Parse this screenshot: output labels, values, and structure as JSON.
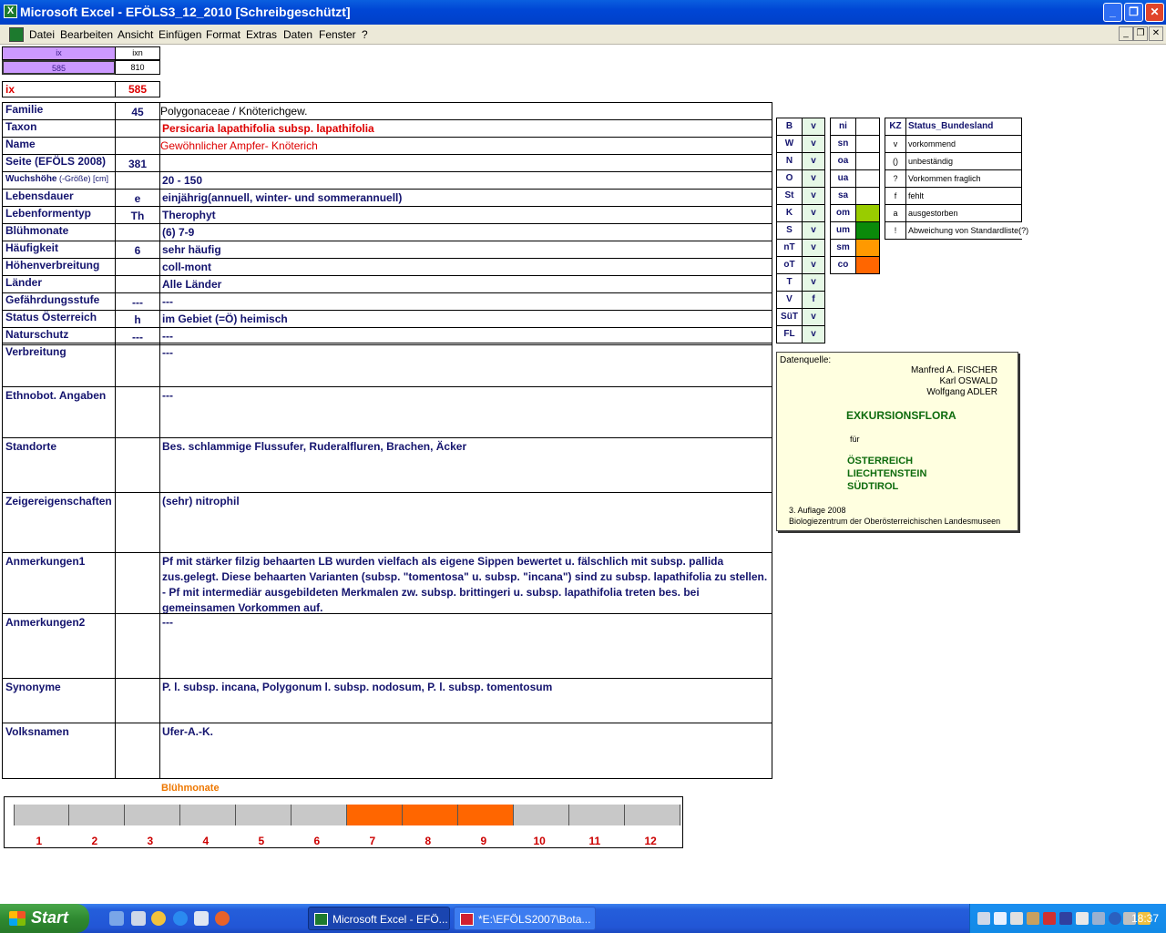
{
  "window": {
    "title": "Microsoft Excel - EFÖLS3_12_2010  [Schreibgeschützt]",
    "app_icon": "excel-icon"
  },
  "menu": [
    "Datei",
    "Bearbeiten",
    "Ansicht",
    "Einfügen",
    "Format",
    "Extras",
    "Daten",
    "Fenster",
    "?"
  ],
  "top_cells": {
    "ix_header": "ix",
    "ixn_header": "ixn",
    "ix_value": "585",
    "ixn_value": "810",
    "ix_label": "ix",
    "ix_big": "585"
  },
  "rows": [
    {
      "label": "Familie",
      "code": "45",
      "value": "Polygonaceae  /  Knöterichgew."
    },
    {
      "label": "Taxon",
      "code": "",
      "value": "Persicaria lapathifolia subsp. lapathifolia"
    },
    {
      "label": "Name",
      "code": "",
      "value": "Gewöhnlicher Ampfer- Knöterich"
    },
    {
      "label": "Seite (EFÖLS 2008)",
      "code": "381",
      "value": ""
    },
    {
      "label": "Wuchshöhe",
      "label_sub": "(-Größe) [cm]",
      "code": "",
      "value": " 20 - 150"
    },
    {
      "label": "Lebensdauer",
      "code": "e",
      "value": "einjährig(annuell, winter- und sommerannuell)"
    },
    {
      "label": "Lebenformentyp",
      "code": "Th",
      "value": "Therophyt"
    },
    {
      "label": "Blühmonate",
      "code": "",
      "value": "(6) 7-9"
    },
    {
      "label": "Häufigkeit",
      "code": "6",
      "value": "sehr häufig"
    },
    {
      "label": "Höhenverbreitung",
      "code": "",
      "value": "coll-mont"
    },
    {
      "label": "Länder",
      "code": "",
      "value": "Alle Länder"
    },
    {
      "label": "Gefährdungsstufe",
      "code": "---",
      "value": "  ---"
    },
    {
      "label": "Status Österreich",
      "code": "h",
      "value": "im Gebiet (=Ö) heimisch"
    },
    {
      "label": "Naturschutz",
      "code": "---",
      "value": " ---"
    }
  ],
  "tall_rows": [
    {
      "label": "Verbreitung",
      "value": " ---"
    },
    {
      "label": "Ethnobot. Angaben",
      "value": "---"
    },
    {
      "label": "Standorte",
      "value": "Bes. schlammige Flussufer, Ruderalfluren, Brachen, Äcker"
    },
    {
      "label": "Zeigereigenschaften",
      "value": "(sehr) nitrophil"
    },
    {
      "label": "Anmerkungen1",
      "value": "Pf mit stärker filzig behaarten LB wurden vielfach als eigene Sippen bewertet u. fälschlich mit subsp. pallida zus.gelegt. Diese behaarten Varianten (subsp. \"tomentosa\" u. subsp. \"incana\") sind zu subsp. lapathifolia zu stellen. - Pf mit intermediär ausgebildeten Merkmalen zw. subsp. brittingeri u. subsp. lapathifolia treten bes. bei gemeinsamen Vorkommen auf."
    },
    {
      "label": "Anmerkungen2",
      "value": "---"
    },
    {
      "label": "Synonyme",
      "value": "P. l. subsp. incana, Polygonum l. subsp. nodosum, P. l. subsp. tomentosum"
    },
    {
      "label": "Volksnamen",
      "value": "Ufer-A.-K."
    }
  ],
  "states": [
    {
      "code": "B",
      "status": "v"
    },
    {
      "code": "W",
      "status": "v"
    },
    {
      "code": "N",
      "status": "v"
    },
    {
      "code": "O",
      "status": "v"
    },
    {
      "code": "St",
      "status": "v"
    },
    {
      "code": "K",
      "status": "v"
    },
    {
      "code": "S",
      "status": "v"
    },
    {
      "code": "nT",
      "status": "v"
    },
    {
      "code": "oT",
      "status": "v"
    },
    {
      "code": "T",
      "status": "v"
    },
    {
      "code": "V",
      "status": "f"
    },
    {
      "code": "SüT",
      "status": "v"
    },
    {
      "code": "FL",
      "status": "v"
    }
  ],
  "zones": [
    {
      "code": "ni",
      "color": "#ffffff"
    },
    {
      "code": "sn",
      "color": "#ffffff"
    },
    {
      "code": "oa",
      "color": "#ffffff"
    },
    {
      "code": "ua",
      "color": "#ffffff"
    },
    {
      "code": "sa",
      "color": "#ffffff"
    },
    {
      "code": "om",
      "color": "#99cc00"
    },
    {
      "code": "um",
      "color": "#0a8a0a"
    },
    {
      "code": "sm",
      "color": "#ff9900"
    },
    {
      "code": "co",
      "color": "#ff6600"
    }
  ],
  "legend": {
    "header_code": "KZ",
    "header_label": "Status_Bundesland",
    "items": [
      {
        "code": "v",
        "label": "vorkommend"
      },
      {
        "code": "()",
        "label": "unbeständig"
      },
      {
        "code": "?",
        "label": "Vorkommen fraglich"
      },
      {
        "code": "f",
        "label": "fehlt"
      },
      {
        "code": "a",
        "label": "ausgestorben"
      },
      {
        "code": "!",
        "label": "Abweichung von Standardliste(?)"
      }
    ]
  },
  "source": {
    "heading": "Datenquelle:",
    "authors": [
      "Manfred A. FISCHER",
      "Karl OSWALD",
      "Wolfgang ADLER"
    ],
    "title": "EXKURSIONSFLORA",
    "fuer": "für",
    "countries": [
      "ÖSTERREICH",
      "LIECHTENSTEIN",
      "SÜDTIROL"
    ],
    "edition": "3. Auflage 2008",
    "publisher": "Biologiezentrum der Oberösterreichischen Landesmuseen"
  },
  "bloom": {
    "title": "Blühmonate",
    "months": [
      "1",
      "2",
      "3",
      "4",
      "5",
      "6",
      "7",
      "8",
      "9",
      "10",
      "11",
      "12"
    ],
    "active": [
      false,
      false,
      false,
      false,
      false,
      false,
      true,
      true,
      true,
      false,
      false,
      false
    ],
    "active_color": "#ff6600",
    "inactive_color": "#c8c8c8"
  },
  "taskbar": {
    "start": "Start",
    "tasks": [
      "Microsoft Excel - EFÖ...",
      "*E:\\EFÖLS2007\\Bota..."
    ],
    "clock": "18:37"
  }
}
